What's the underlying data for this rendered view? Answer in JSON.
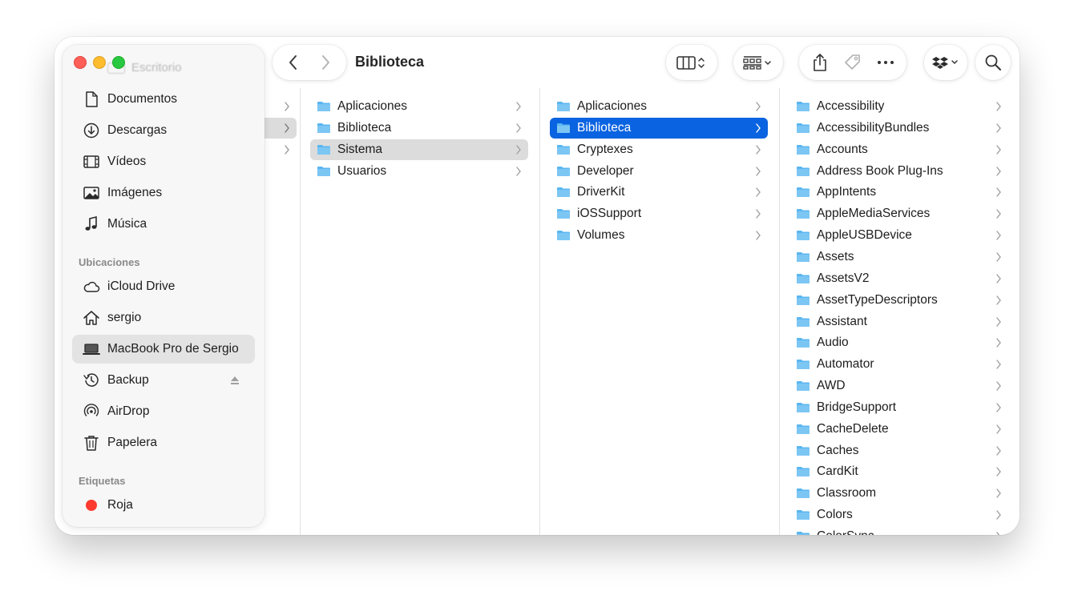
{
  "window": {
    "title": "Biblioteca"
  },
  "sidebar": {
    "ghost_item": "Escritorio",
    "favorites": [
      {
        "label": "Documentos",
        "icon": "document-icon"
      },
      {
        "label": "Descargas",
        "icon": "download-icon"
      },
      {
        "label": "Vídeos",
        "icon": "film-icon"
      },
      {
        "label": "Imágenes",
        "icon": "photo-icon"
      },
      {
        "label": "Música",
        "icon": "music-note-icon"
      }
    ],
    "locations_header": "Ubicaciones",
    "locations": [
      {
        "label": "iCloud Drive",
        "icon": "cloud-icon"
      },
      {
        "label": "sergio",
        "icon": "home-icon"
      },
      {
        "label": "MacBook Pro de Sergio",
        "icon": "laptop-icon",
        "selected": true
      },
      {
        "label": "Backup",
        "icon": "time-machine-icon",
        "eject": true
      },
      {
        "label": "AirDrop",
        "icon": "airdrop-icon"
      },
      {
        "label": "Papelera",
        "icon": "trash-icon"
      }
    ],
    "tags_header": "Etiquetas",
    "tags": [
      {
        "label": "Roja",
        "color": "#ff3b30"
      }
    ]
  },
  "columns": {
    "col2": [
      "Aplicaciones",
      "Biblioteca",
      "Sistema",
      "Usuarios"
    ],
    "col2_selected": "Sistema",
    "col3": [
      "Aplicaciones",
      "Biblioteca",
      "Cryptexes",
      "Developer",
      "DriverKit",
      "iOSSupport",
      "Volumes"
    ],
    "col3_selected": "Biblioteca",
    "col4": [
      "Accessibility",
      "AccessibilityBundles",
      "Accounts",
      "Address Book Plug-Ins",
      "AppIntents",
      "AppleMediaServices",
      "AppleUSBDevice",
      "Assets",
      "AssetsV2",
      "AssetTypeDescriptors",
      "Assistant",
      "Audio",
      "Automator",
      "AWD",
      "BridgeSupport",
      "CacheDelete",
      "Caches",
      "CardKit",
      "Classroom",
      "Colors",
      "ColorSync"
    ]
  },
  "colors": {
    "selection": "#0a63e0",
    "folder": "#5ab6f0"
  }
}
